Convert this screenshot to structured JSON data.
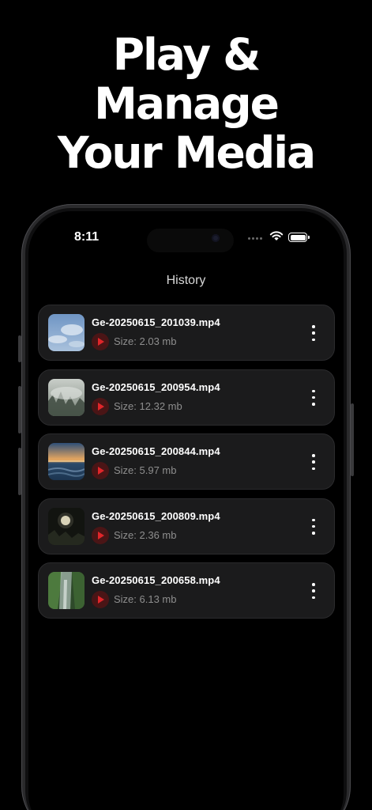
{
  "headline": {
    "line1": "Play &",
    "line2": "Manage",
    "line3": "Your Media"
  },
  "status_bar": {
    "time": "8:11",
    "icons": [
      "signal-dots-icon",
      "wifi-icon",
      "battery-icon"
    ]
  },
  "screen": {
    "title": "History"
  },
  "history": [
    {
      "filename": "Ge-20250615_201039.mp4",
      "size": "Size: 2.03 mb",
      "thumbnail": "sky-thumbnail",
      "menu_icon": "more-vertical-icon"
    },
    {
      "filename": "Ge-20250615_200954.mp4",
      "size": "Size: 12.32 mb",
      "thumbnail": "fog-forest-thumbnail",
      "menu_icon": "more-vertical-icon"
    },
    {
      "filename": "Ge-20250615_200844.mp4",
      "size": "Size: 5.97 mb",
      "thumbnail": "sunset-sea-thumbnail",
      "menu_icon": "more-vertical-icon"
    },
    {
      "filename": "Ge-20250615_200809.mp4",
      "size": "Size: 2.36 mb",
      "thumbnail": "moon-night-thumbnail",
      "menu_icon": "more-vertical-icon"
    },
    {
      "filename": "Ge-20250615_200658.mp4",
      "size": "Size: 6.13 mb",
      "thumbnail": "waterfall-thumbnail",
      "menu_icon": "more-vertical-icon"
    }
  ],
  "colors": {
    "background": "#000000",
    "card": "#1b1b1c",
    "accent_red": "#e0262a",
    "play_bg": "#4a1516",
    "muted_text": "#8e8e8e"
  }
}
